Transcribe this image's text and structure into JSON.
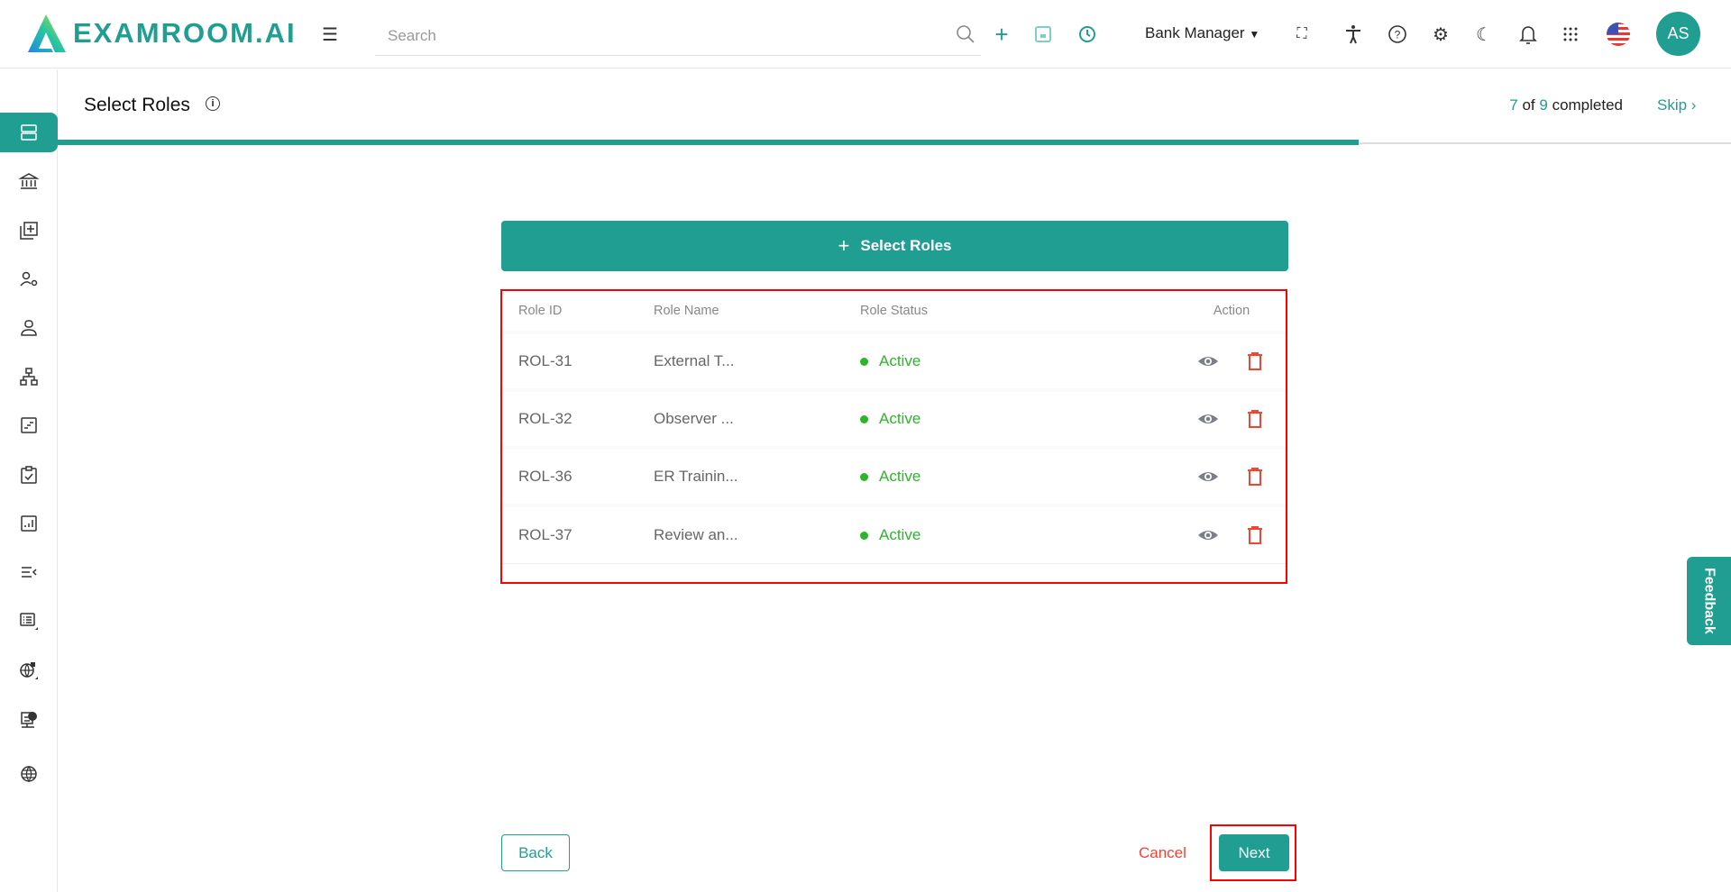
{
  "header": {
    "logo_text": "EXAMROOM.AI",
    "search_placeholder": "Search",
    "role_selector": "Bank Manager",
    "avatar_initials": "AS",
    "icons": [
      "menu-icon",
      "search-icon",
      "plus-icon",
      "save-icon",
      "history-icon",
      "fullscreen-icon",
      "accessibility-icon",
      "help-icon",
      "settings-icon",
      "dark-mode-icon",
      "notification-icon",
      "apps-icon",
      "us-flag-icon"
    ]
  },
  "sidebar": {
    "items": [
      "dashboard",
      "institution",
      "add-content",
      "user-settings",
      "user",
      "hierarchy",
      "forms",
      "checklist",
      "reports",
      "collapse-list",
      "list",
      "global-settings",
      "server",
      "globe"
    ],
    "active_index": 0
  },
  "page": {
    "title": "Select Roles",
    "info_symbol": "i",
    "progress": {
      "current": "7",
      "of_label": "of",
      "total": "9",
      "suffix": "completed",
      "fraction": 0.7778
    },
    "skip_label": "Skip ›"
  },
  "select_roles_button": {
    "icon": "+",
    "label": "Select Roles"
  },
  "table": {
    "headers": [
      "Role ID",
      "Role Name",
      "Role Status",
      "Action"
    ],
    "rows": [
      {
        "id": "ROL-31",
        "name": "External T...",
        "status": "Active"
      },
      {
        "id": "ROL-32",
        "name": "Observer ...",
        "status": "Active"
      },
      {
        "id": "ROL-36",
        "name": "ER Trainin...",
        "status": "Active"
      },
      {
        "id": "ROL-37",
        "name": "Review an...",
        "status": "Active"
      }
    ]
  },
  "footer": {
    "back": "Back",
    "cancel": "Cancel",
    "next": "Next"
  },
  "feedback_label": "Feedback",
  "colors": {
    "brand": "#209e91",
    "danger": "#f44336",
    "active": "#2bb52b",
    "highlight": "#ff0000"
  }
}
